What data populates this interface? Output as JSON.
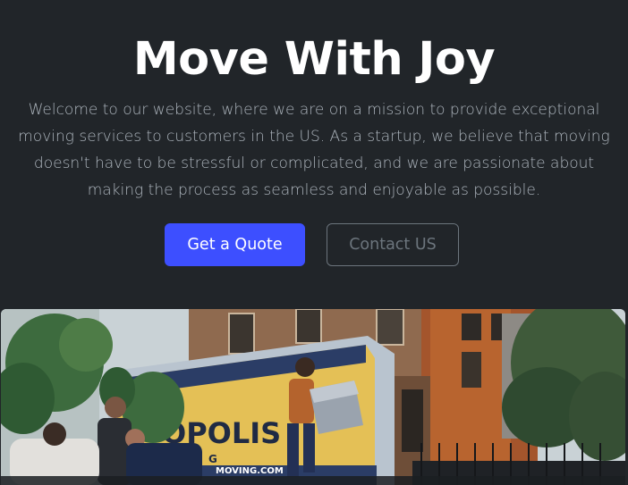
{
  "hero": {
    "title": "Move With Joy",
    "lead": "Welcome to our website, where we are on a mission to provide exceptional moving services to customers in the US. As a startup, we believe that moving doesn't have to be stressful or complicated, and we are passionate about making the process as seamless and enjoyable as possible."
  },
  "buttons": {
    "quote_label": "Get a Quote",
    "contact_label": "Contact US"
  },
  "photo": {
    "truck_text": "OPOLIS",
    "truck_small_text": "G",
    "truck_url_text": "MOVING.COM"
  },
  "colors": {
    "background": "#212529",
    "title": "#ffffff",
    "lead": "#adb5bd",
    "primary": "#3d4fff",
    "outline": "#6c757d"
  }
}
